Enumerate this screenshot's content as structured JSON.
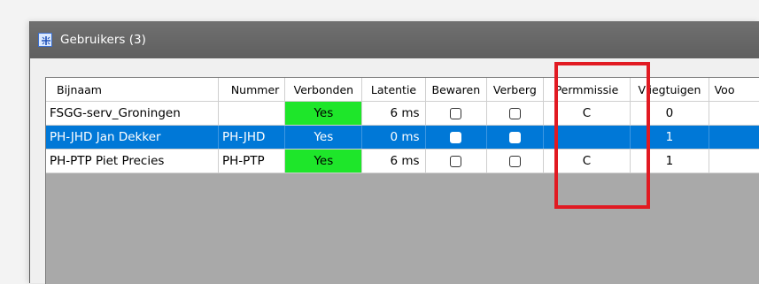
{
  "window": {
    "title": "Gebruikers (3)"
  },
  "columns": [
    "Bijnaam",
    "Nummer",
    "Verbonden",
    "Latentie",
    "Bewaren",
    "Verberg",
    "Permmissie",
    "Vliegtuigen",
    "Voo"
  ],
  "rows": [
    {
      "bijnaam": "FSGG-serv_Groningen",
      "nummer": "",
      "verbonden": "Yes",
      "latentie": "6 ms",
      "bewaren": false,
      "verberg": false,
      "permissie": "C",
      "vliegtuigen": "0",
      "selected": false
    },
    {
      "bijnaam": "PH-JHD  Jan Dekker",
      "nummer": "PH-JHD",
      "verbonden": "Yes",
      "latentie": "0 ms",
      "bewaren": false,
      "verberg": false,
      "permissie": "",
      "vliegtuigen": "1",
      "selected": true
    },
    {
      "bijnaam": "PH-PTP  Piet Precies",
      "nummer": "PH-PTP",
      "verbonden": "Yes",
      "latentie": "6 ms",
      "bewaren": false,
      "verberg": false,
      "permissie": "C",
      "vliegtuigen": "1",
      "selected": false
    }
  ],
  "colors": {
    "connected_green": "#1ee62a",
    "selection_blue": "#0078d7",
    "highlight_red": "#e11a22",
    "titlebar": "#666666"
  },
  "icons": {
    "app": "users-window-icon"
  }
}
